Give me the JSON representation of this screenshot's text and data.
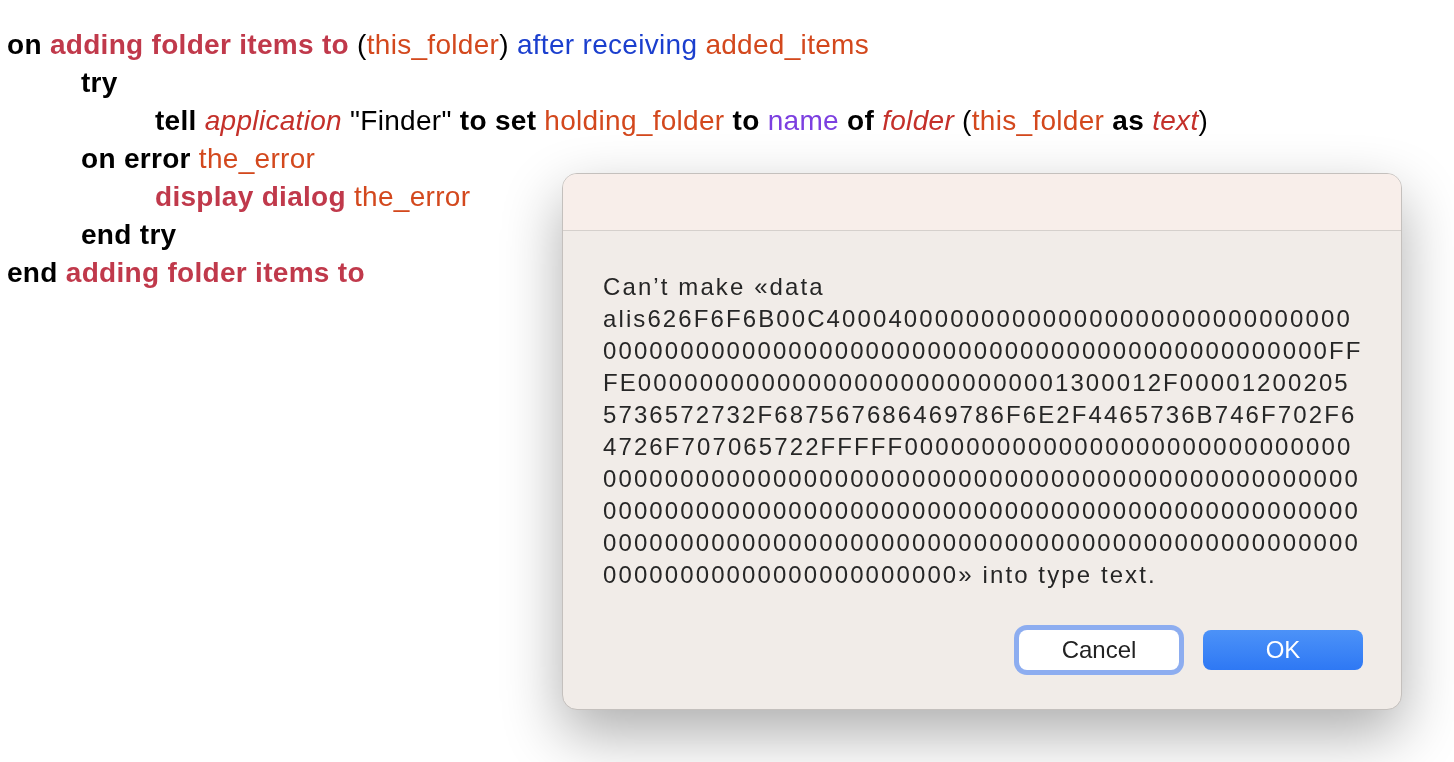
{
  "script": {
    "lines": [
      {
        "words": [
          [
            {
              "kind": "keyword",
              "text": "on"
            }
          ],
          [
            {
              "kind": "handler",
              "text": "adding folder items to"
            }
          ],
          [
            {
              "kind": "punctuation",
              "text": "("
            },
            {
              "kind": "variable",
              "text": "this_folder"
            },
            {
              "kind": "punctuation",
              "text": ")"
            }
          ],
          [
            {
              "kind": "parameter",
              "text": "after receiving"
            }
          ],
          [
            {
              "kind": "variable",
              "text": "added_items"
            }
          ]
        ],
        "children": [
          {
            "words": [
              [
                {
                  "kind": "keyword",
                  "text": "try"
                }
              ]
            ],
            "children": [
              {
                "words": [
                  [
                    {
                      "kind": "keyword",
                      "text": "tell"
                    }
                  ],
                  [
                    {
                      "kind": "class",
                      "text": "application"
                    }
                  ],
                  [
                    {
                      "kind": "string",
                      "text": "\"Finder\""
                    }
                  ],
                  [
                    {
                      "kind": "keyword",
                      "text": "to set"
                    }
                  ],
                  [
                    {
                      "kind": "variable",
                      "text": "holding_folder"
                    }
                  ],
                  [
                    {
                      "kind": "keyword",
                      "text": "to"
                    }
                  ],
                  [
                    {
                      "kind": "property",
                      "text": "name"
                    }
                  ],
                  [
                    {
                      "kind": "keyword",
                      "text": "of"
                    }
                  ],
                  [
                    {
                      "kind": "class",
                      "text": "folder"
                    }
                  ],
                  [
                    {
                      "kind": "punctuation",
                      "text": "("
                    },
                    {
                      "kind": "variable",
                      "text": "this_folder"
                    }
                  ],
                  [
                    {
                      "kind": "keyword",
                      "text": "as"
                    }
                  ],
                  [
                    {
                      "kind": "class",
                      "text": "text"
                    },
                    {
                      "kind": "punctuation",
                      "text": ")"
                    }
                  ]
                ]
              }
            ]
          },
          {
            "words": [
              [
                {
                  "kind": "keyword",
                  "text": "on error"
                }
              ],
              [
                {
                  "kind": "variable",
                  "text": "the_error"
                }
              ]
            ],
            "children": [
              {
                "words": [
                  [
                    {
                      "kind": "command",
                      "text": "display dialog"
                    }
                  ],
                  [
                    {
                      "kind": "variable",
                      "text": "the_error"
                    }
                  ]
                ]
              }
            ]
          },
          {
            "words": [
              [
                {
                  "kind": "keyword",
                  "text": "end try"
                }
              ]
            ]
          }
        ]
      },
      {
        "words": [
          [
            {
              "kind": "keyword",
              "text": "end"
            }
          ],
          [
            {
              "kind": "handler",
              "text": "adding folder items to"
            }
          ]
        ]
      }
    ]
  },
  "dialog": {
    "message": "Can’t make «data alis626F6F6B00C400040000000000000000000000000000000000000000000000000000000000000000000000000000FFFE0000000000000000000000000001300012F000012002055736572732F687567686469786F6E2F4465736B746F702F64726F707065722FFFFF0000000000000000000000000000000000000000000000000000000000000000000000000000000000000000000000000000000000000000000000000000000000000000000000000000000000000000000000000000000000000000000000000000000» into type text.",
    "buttons": [
      {
        "label": "Cancel",
        "kind": "secondary",
        "focused": true
      },
      {
        "label": "OK",
        "kind": "default",
        "focused": false
      }
    ]
  }
}
